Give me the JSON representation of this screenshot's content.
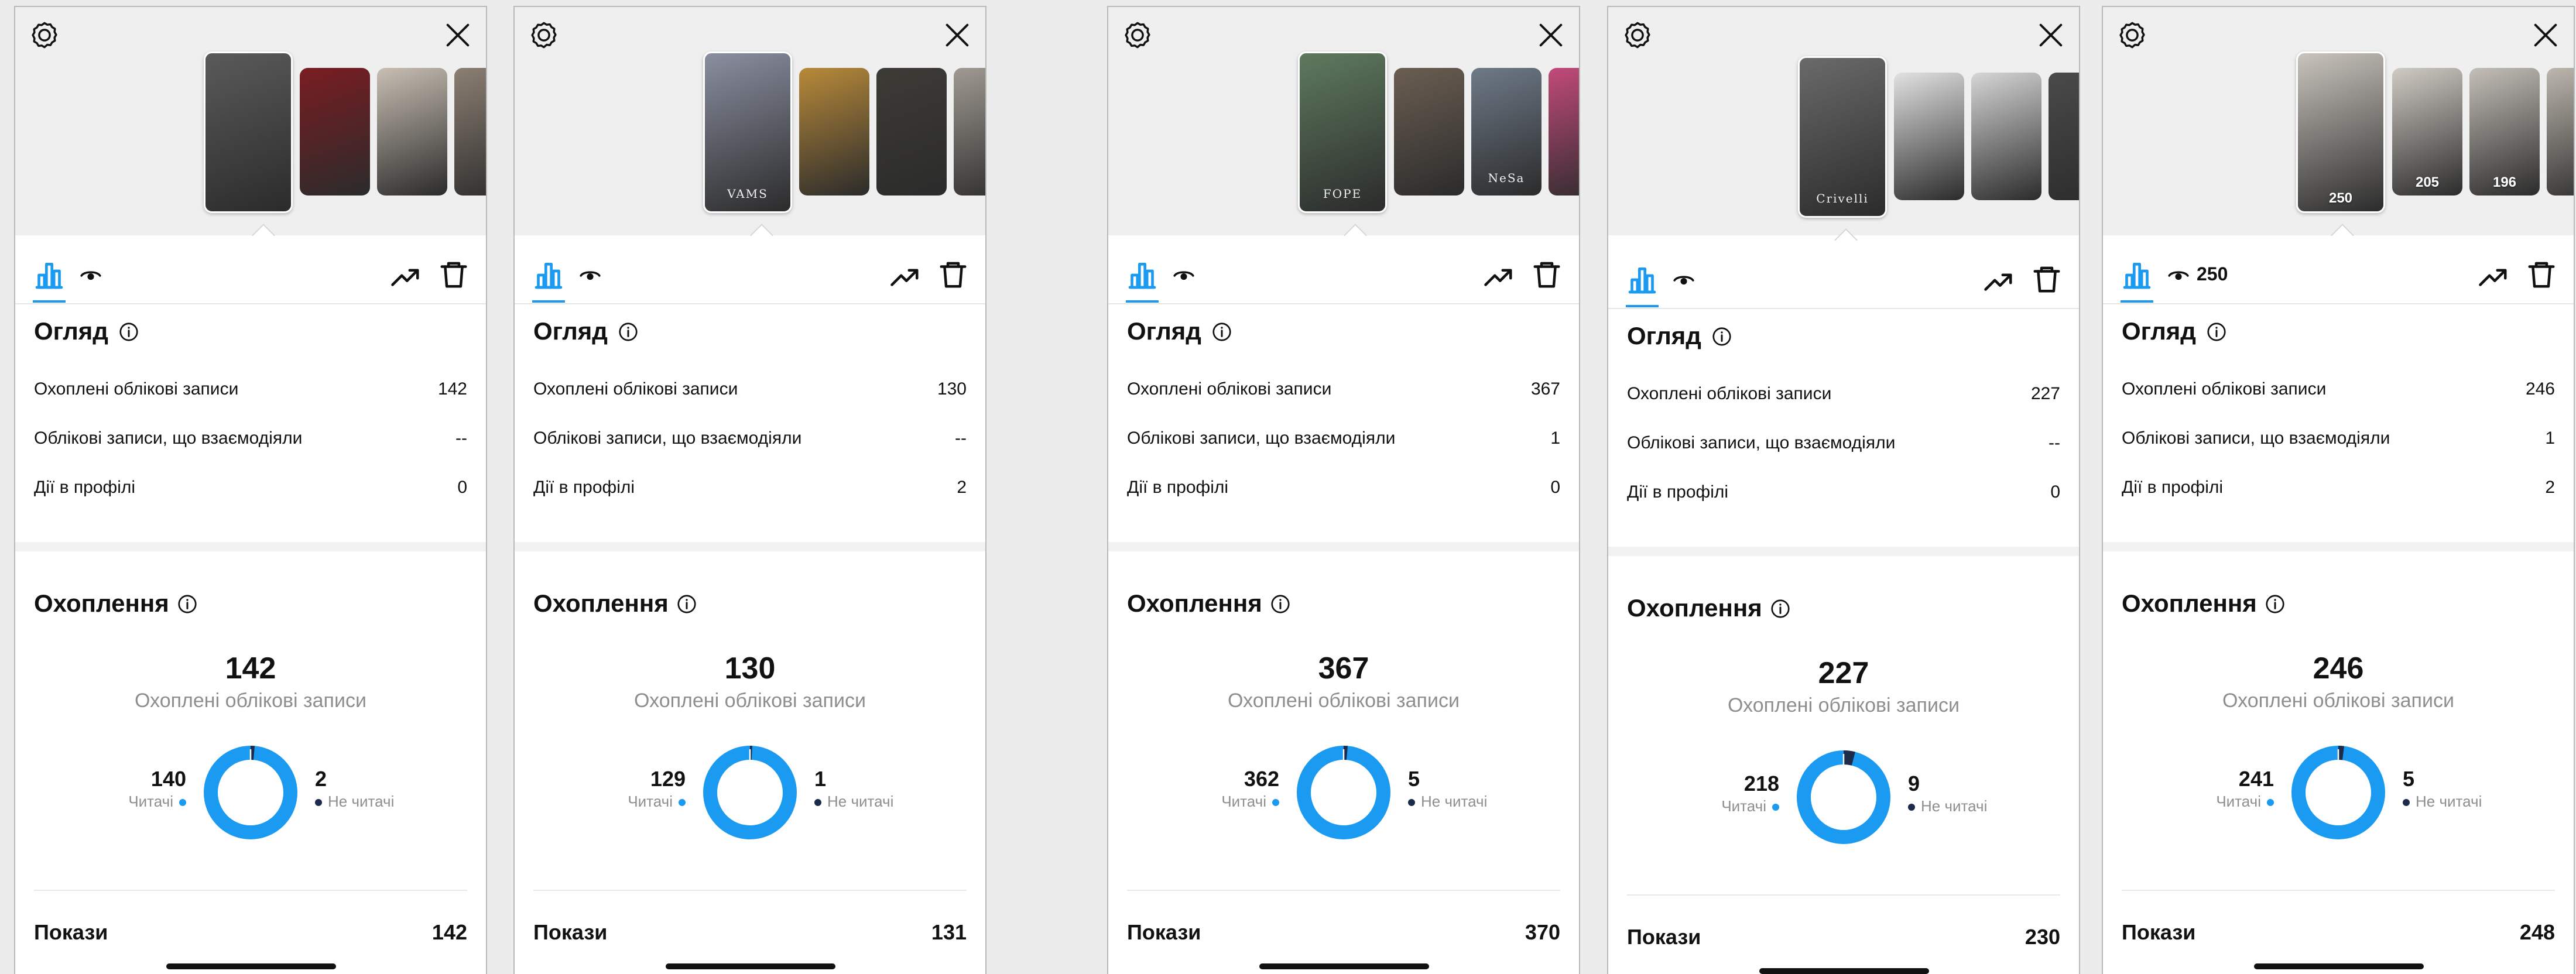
{
  "labels": {
    "overview_title": "Огляд",
    "accounts_reached": "Охоплені облікові записи",
    "accounts_engaged": "Облікові записи, що взаємодіяли",
    "profile_activity": "Дії в профілі",
    "reach_title": "Охоплення",
    "reach_subtitle": "Охоплені облікові записи",
    "followers": "Читачі",
    "non_followers": "Не читачі",
    "impressions": "Покази"
  },
  "colors": {
    "accent_blue": "#1a9af0",
    "dark_navy": "#1c2b4a"
  },
  "panels": [
    {
      "stories": [
        {
          "tone": "#5a5a5a",
          "caption": "",
          "active": true
        },
        {
          "tone": "#7a1d22",
          "caption": ""
        },
        {
          "tone": "#c8bfb3",
          "caption": ""
        },
        {
          "tone": "#8c7f73",
          "caption": ""
        }
      ],
      "eye_count": "",
      "overview": {
        "reached": "142",
        "engaged": "--",
        "profile_activity": "0"
      },
      "reach": {
        "total": "142",
        "followers": "140",
        "non_followers": "2",
        "non_follower_share": 0.014
      },
      "impressions": "142"
    },
    {
      "stories": [
        {
          "tone": "#8a8fa0",
          "caption": "VAMS",
          "active": true
        },
        {
          "tone": "#b88a3a",
          "caption": ""
        },
        {
          "tone": "#3d3b36",
          "caption": ""
        },
        {
          "tone": "#a09a92",
          "caption": ""
        }
      ],
      "eye_count": "",
      "overview": {
        "reached": "130",
        "engaged": "--",
        "profile_activity": "2"
      },
      "reach": {
        "total": "130",
        "followers": "129",
        "non_followers": "1",
        "non_follower_share": 0.008
      },
      "impressions": "131"
    },
    {
      "stories": [
        {
          "tone": "#5e7a5e",
          "caption": "FOPE",
          "active": true
        },
        {
          "tone": "#6b5e52",
          "caption": ""
        },
        {
          "tone": "#6e7a88",
          "caption": "NeSa"
        },
        {
          "tone": "#c24a7a",
          "caption": ""
        }
      ],
      "eye_count": "",
      "overview": {
        "reached": "367",
        "engaged": "1",
        "profile_activity": "0"
      },
      "reach": {
        "total": "367",
        "followers": "362",
        "non_followers": "5",
        "non_follower_share": 0.014
      },
      "impressions": "370"
    },
    {
      "stories": [
        {
          "tone": "#6a6a6a",
          "caption": "Crivelli",
          "active": true
        },
        {
          "tone": "#e2e2e2",
          "caption": ""
        },
        {
          "tone": "#d6d6d6",
          "caption": ""
        },
        {
          "tone": "#4a4a4a",
          "caption": ""
        }
      ],
      "eye_count": "",
      "overview": {
        "reached": "227",
        "engaged": "--",
        "profile_activity": "0"
      },
      "reach": {
        "total": "227",
        "followers": "218",
        "non_followers": "9",
        "non_follower_share": 0.04
      },
      "impressions": "230"
    },
    {
      "stories": [
        {
          "tone": "#c9c4bd",
          "caption": "",
          "views": "250",
          "active": true
        },
        {
          "tone": "#d0cbc4",
          "caption": "",
          "views": "205"
        },
        {
          "tone": "#c4bfb8",
          "caption": "",
          "views": "196"
        },
        {
          "tone": "#bdb7ae",
          "caption": ""
        }
      ],
      "eye_count": "250",
      "overview": {
        "reached": "246",
        "engaged": "1",
        "profile_activity": "2"
      },
      "reach": {
        "total": "246",
        "followers": "241",
        "non_followers": "5",
        "non_follower_share": 0.02
      },
      "impressions": "248"
    }
  ]
}
